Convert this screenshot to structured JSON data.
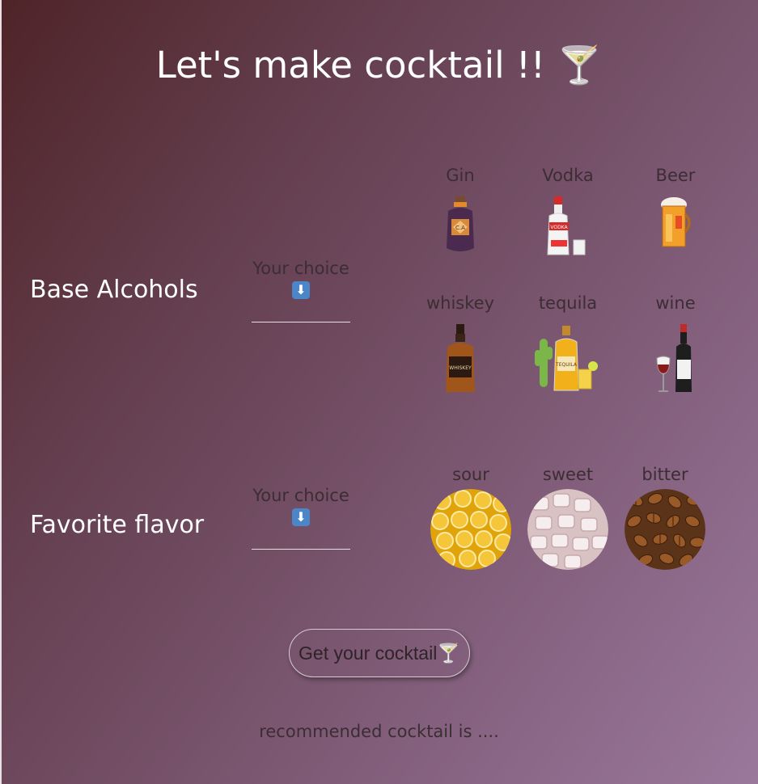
{
  "page": {
    "title": "Let's make cocktail !! 🍸",
    "frame_color": "#e8e0e4"
  },
  "base": {
    "label": "Base Alcohols",
    "choice_label": "Your choice",
    "choice_arrow": "⬇",
    "items": [
      {
        "label": "Gin",
        "icon": "gin-bottle-icon"
      },
      {
        "label": "Vodka",
        "icon": "vodka-bottle-icon"
      },
      {
        "label": "Beer",
        "icon": "beer-glass-icon"
      },
      {
        "label": "whiskey",
        "icon": "whiskey-bottle-icon"
      },
      {
        "label": "tequila",
        "icon": "tequila-bottle-icon"
      },
      {
        "label": "wine",
        "icon": "wine-bottle-icon"
      }
    ]
  },
  "flavor": {
    "label": "Favorite flavor",
    "choice_label": "Your choice",
    "choice_arrow": "⬇",
    "items": [
      {
        "label": "sour",
        "image": "lemon-slices-image"
      },
      {
        "label": "sweet",
        "image": "marshmallows-image"
      },
      {
        "label": "bitter",
        "image": "coffee-beans-image"
      }
    ]
  },
  "action": {
    "button_label": "Get your cocktail🍸"
  },
  "result": {
    "text": "recommended cocktail is ...."
  }
}
